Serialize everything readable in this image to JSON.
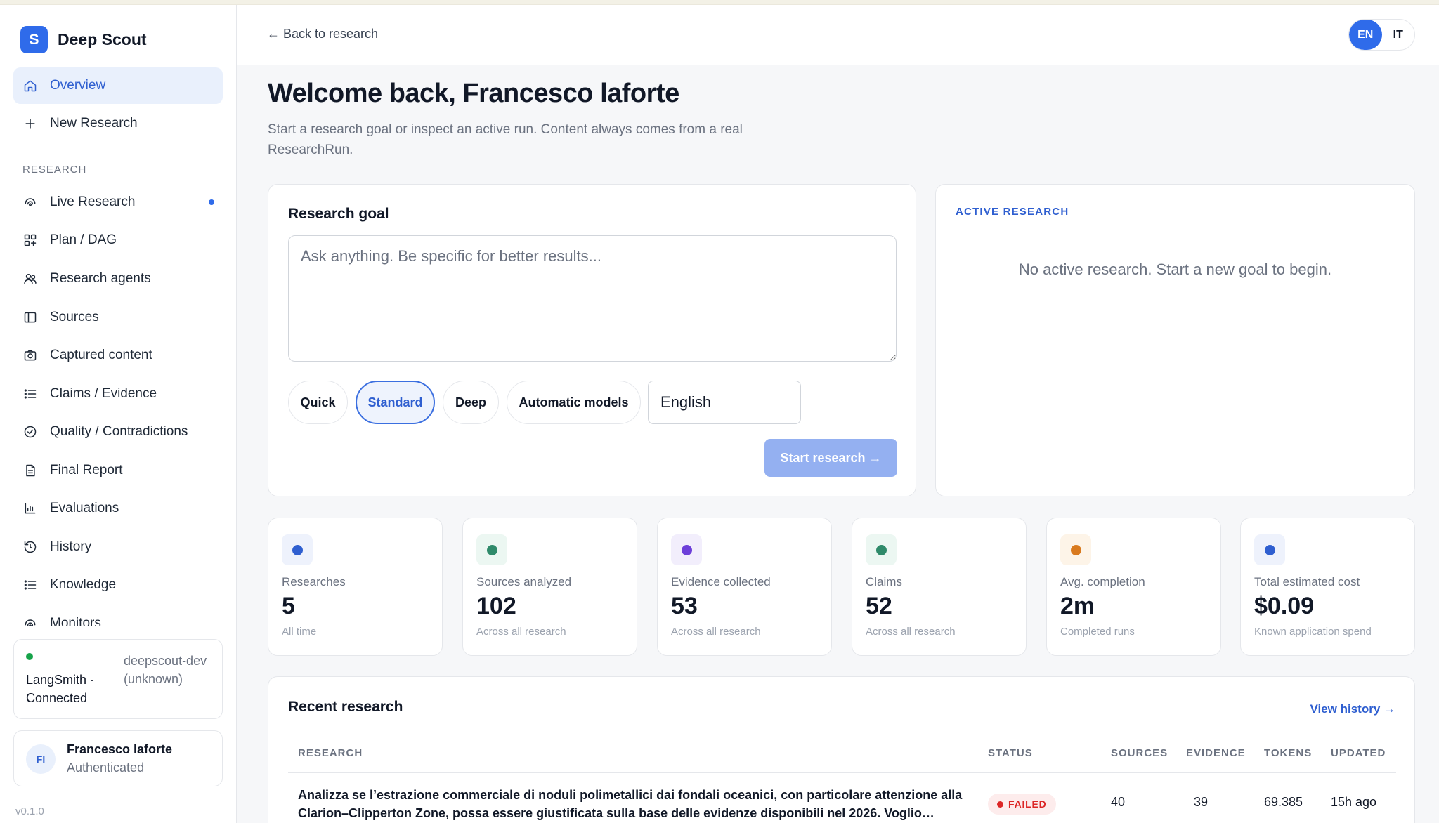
{
  "brand": {
    "logo_letter": "S",
    "name": "Deep Scout"
  },
  "nav": {
    "overview": "Overview",
    "new_research": "New Research",
    "section_research": "RESEARCH",
    "live_research": "Live Research",
    "plan": "Plan / DAG",
    "agents": "Research agents",
    "sources": "Sources",
    "captured": "Captured content",
    "claims": "Claims / Evidence",
    "quality": "Quality / Contradictions",
    "final_report": "Final Report",
    "evaluations": "Evaluations",
    "history": "History",
    "knowledge": "Knowledge",
    "monitors": "Monitors"
  },
  "connection": {
    "title": "LangSmith · Connected",
    "env": "deepscout-dev (unknown)"
  },
  "user": {
    "initials": "FI",
    "name": "Francesco laforte",
    "status": "Authenticated"
  },
  "version": "v0.1.0",
  "topbar": {
    "back": "← Back to research",
    "lang_en": "EN",
    "lang_it": "IT"
  },
  "header": {
    "welcome": "Welcome back, Francesco laforte",
    "subtitle": "Start a research goal or inspect an active run. Content always comes from a real ResearchRun."
  },
  "goal": {
    "title": "Research goal",
    "placeholder": "Ask anything. Be specific for better results...",
    "value": "",
    "depth_options": [
      "Quick",
      "Standard",
      "Deep"
    ],
    "depth_selected": "Standard",
    "models": "Automatic models",
    "language": "English",
    "start": "Start research →"
  },
  "active": {
    "label": "ACTIVE RESEARCH",
    "empty": "No active research. Start a new goal to begin."
  },
  "stats": [
    {
      "label": "Researches",
      "value": "5",
      "sub": "All time",
      "color": "#2f5fd0",
      "bg": "#eef2fc"
    },
    {
      "label": "Sources analyzed",
      "value": "102",
      "sub": "Across all research",
      "color": "#2f8a6a",
      "bg": "#ecf7f2"
    },
    {
      "label": "Evidence collected",
      "value": "53",
      "sub": "Across all research",
      "color": "#6d3fd9",
      "bg": "#f2eefc"
    },
    {
      "label": "Claims",
      "value": "52",
      "sub": "Across all research",
      "color": "#2f8a6a",
      "bg": "#ecf7f2"
    },
    {
      "label": "Avg. completion",
      "value": "2m",
      "sub": "Completed runs",
      "color": "#d97a1e",
      "bg": "#fdf4e8"
    },
    {
      "label": "Total estimated cost",
      "value": "$0.09",
      "sub": "Known application spend",
      "color": "#2f5fd0",
      "bg": "#eef2fc"
    }
  ],
  "recent": {
    "title": "Recent research",
    "view_history": "View history →",
    "columns": [
      "RESEARCH",
      "STATUS",
      "SOURCES",
      "EVIDENCE",
      "TOKENS",
      "UPDATED"
    ],
    "rows": [
      {
        "research": "Analizza se l’estrazione commerciale di noduli polimetallici dai fondali oceanici, con particolare attenzione alla Clarion–Clipperton Zone, possa essere giustificata sulla base delle evidenze disponibili nel 2026. Voglio…",
        "status": "FAILED",
        "sources": "40",
        "evidence": "39",
        "tokens": "69.385",
        "updated": "15h ago"
      }
    ]
  }
}
